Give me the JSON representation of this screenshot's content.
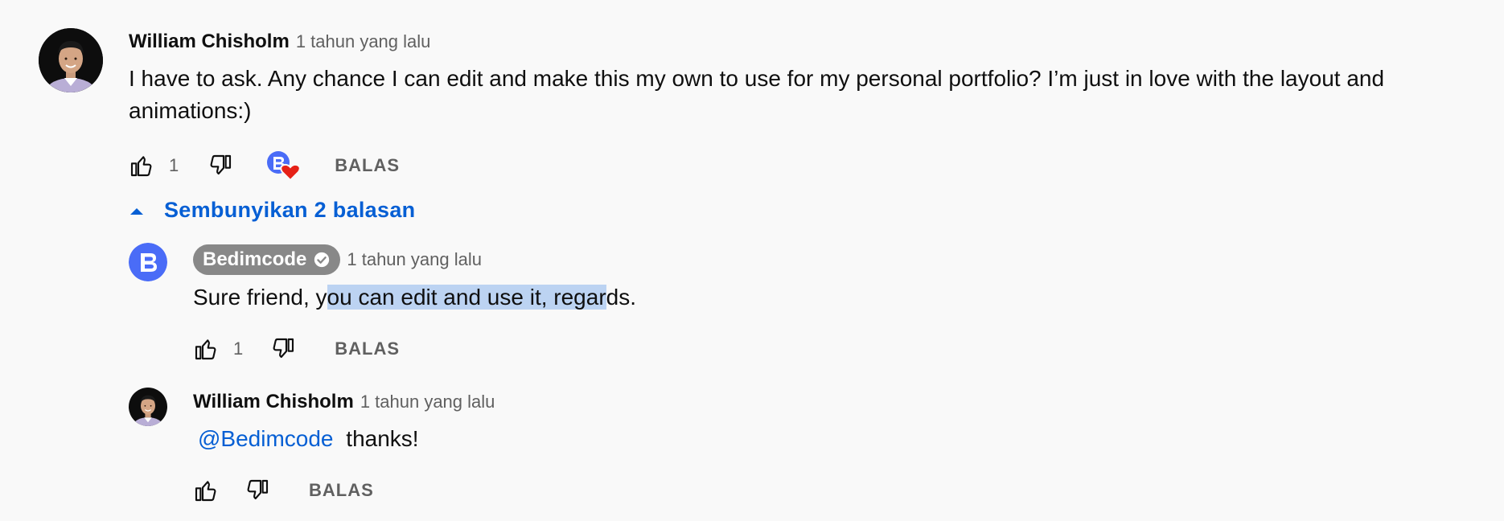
{
  "comment": {
    "author": "William Chisholm",
    "time": "1 tahun yang lalu",
    "text_line1": "I have to ask. Any chance I can edit and make this my own to use for my personal portfolio? I’m just in love with the layout and",
    "text_line2": "animations:)",
    "likes": "1",
    "reply_label": "BALAS"
  },
  "replies_toggle": {
    "label": "Sembunyikan 2 balasan"
  },
  "replies": [
    {
      "author": "Bedimcode",
      "time": "1 tahun yang lalu",
      "text_before": "Sure friend, y",
      "text_selected": "ou can edit and use it, regar",
      "text_after": "ds.",
      "likes": "1",
      "reply_label": "BALAS"
    },
    {
      "author": "William Chisholm",
      "time": "1 tahun yang lalu",
      "mention": "@Bedimcode",
      "text": "thanks!",
      "reply_label": "BALAS"
    }
  ],
  "colors": {
    "background": "#f9f9f9",
    "link_blue": "#065fd4",
    "channel_blue": "#4a6cf7",
    "heart_red": "#e62117",
    "badge_gray": "#888888",
    "selection": "#bcd3f2"
  },
  "icons": [
    "thumb-up-icon",
    "thumb-down-icon",
    "creator-heart-icon",
    "caret-up-icon",
    "verified-check-icon"
  ]
}
